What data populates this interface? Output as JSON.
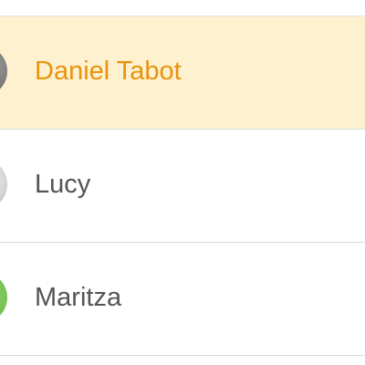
{
  "contacts": [
    {
      "name": "Daniel Tabot",
      "selected": true,
      "avatar": "gray-avatar"
    },
    {
      "name": "Lucy",
      "selected": false,
      "avatar": "photo-avatar"
    },
    {
      "name": "Maritza",
      "selected": false,
      "avatar": "green-avatar"
    }
  ],
  "colors": {
    "selected_background": "#fdf1cf",
    "selected_text": "#e8930c",
    "text": "#545454",
    "divider": "#dcdcdc"
  }
}
